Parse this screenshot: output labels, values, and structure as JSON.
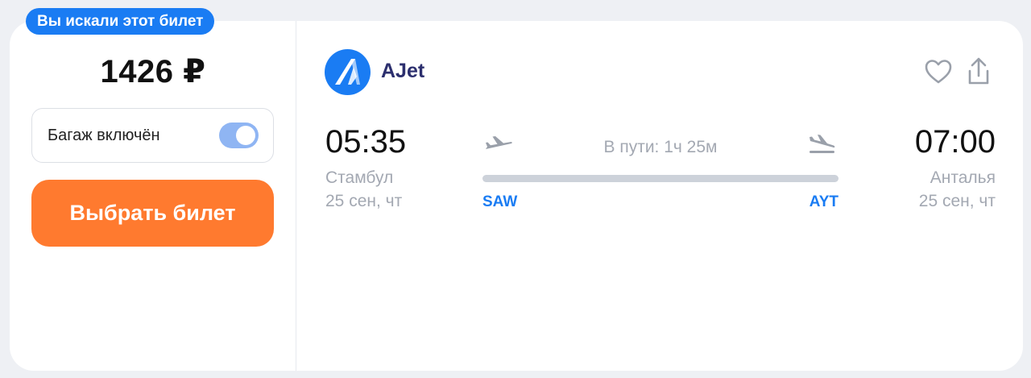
{
  "badge": {
    "label": "Вы искали этот билет"
  },
  "price": {
    "value": "1426 ₽"
  },
  "baggage": {
    "label": "Багаж включён",
    "enabled": true
  },
  "select_button": {
    "label": "Выбрать билет"
  },
  "airline": {
    "name": "AJet",
    "logo_icon": "ajet-logo-icon"
  },
  "actions": {
    "favorite_icon": "heart-icon",
    "share_icon": "share-icon"
  },
  "departure": {
    "time": "05:35",
    "city": "Стамбул",
    "date": "25 сен, чт",
    "iata": "SAW"
  },
  "arrival": {
    "time": "07:00",
    "city": "Анталья",
    "date": "25 сен, чт",
    "iata": "AYT"
  },
  "flight": {
    "duration": "В пути: 1ч 25м"
  },
  "colors": {
    "accent": "#1a7cf3",
    "button": "#ff7a2f",
    "airline_text": "#2c2f6e",
    "muted": "#a3a8b2"
  }
}
